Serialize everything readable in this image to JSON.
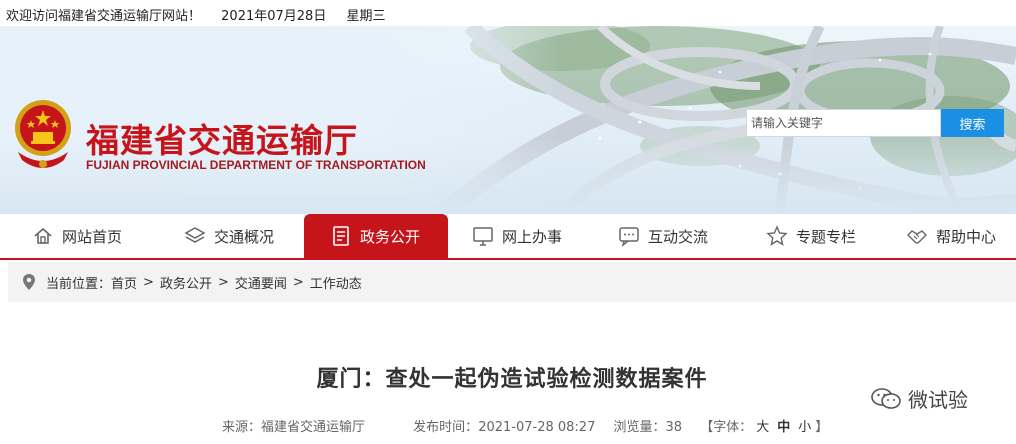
{
  "topbar": {
    "welcome": "欢迎访问福建省交通运输厅网站！",
    "date": "2021年07月28日",
    "weekday": "星期三"
  },
  "header": {
    "title": "福建省交通运输厅",
    "subtitle": "FUJIAN PROVINCIAL DEPARTMENT OF TRANSPORTATION",
    "emblem_icon": "national-emblem-icon",
    "search_placeholder": "请输入关键字",
    "search_button": "搜索"
  },
  "nav": {
    "items": [
      {
        "label": "网站首页",
        "icon": "home-icon"
      },
      {
        "label": "交通概况",
        "icon": "layers-icon"
      },
      {
        "label": "政务公开",
        "icon": "document-icon",
        "active": true
      },
      {
        "label": "网上办事",
        "icon": "monitor-icon"
      },
      {
        "label": "互动交流",
        "icon": "chat-icon"
      },
      {
        "label": "专题专栏",
        "icon": "star-icon"
      },
      {
        "label": "帮助中心",
        "icon": "handshake-icon"
      }
    ],
    "accent": "#c6141b"
  },
  "breadcrumb": {
    "prefix": "当前位置：",
    "items": [
      "首页",
      "政务公开",
      "交通要闻",
      "工作动态"
    ],
    "separator": ">"
  },
  "article": {
    "title": "厦门：查处一起伪造试验检测数据案件",
    "source_label": "来源：",
    "source": "福建省交通运输厅",
    "time_label": "发布时间：",
    "time": "2021-07-28 08:27",
    "views_label": "浏览量：",
    "views": "38",
    "font_prefix": "【字体：",
    "font_large": "大",
    "font_medium": "中",
    "font_small": "小",
    "font_suffix": "】"
  },
  "watermark": {
    "text": "微试验",
    "icon": "wechat-icon"
  }
}
